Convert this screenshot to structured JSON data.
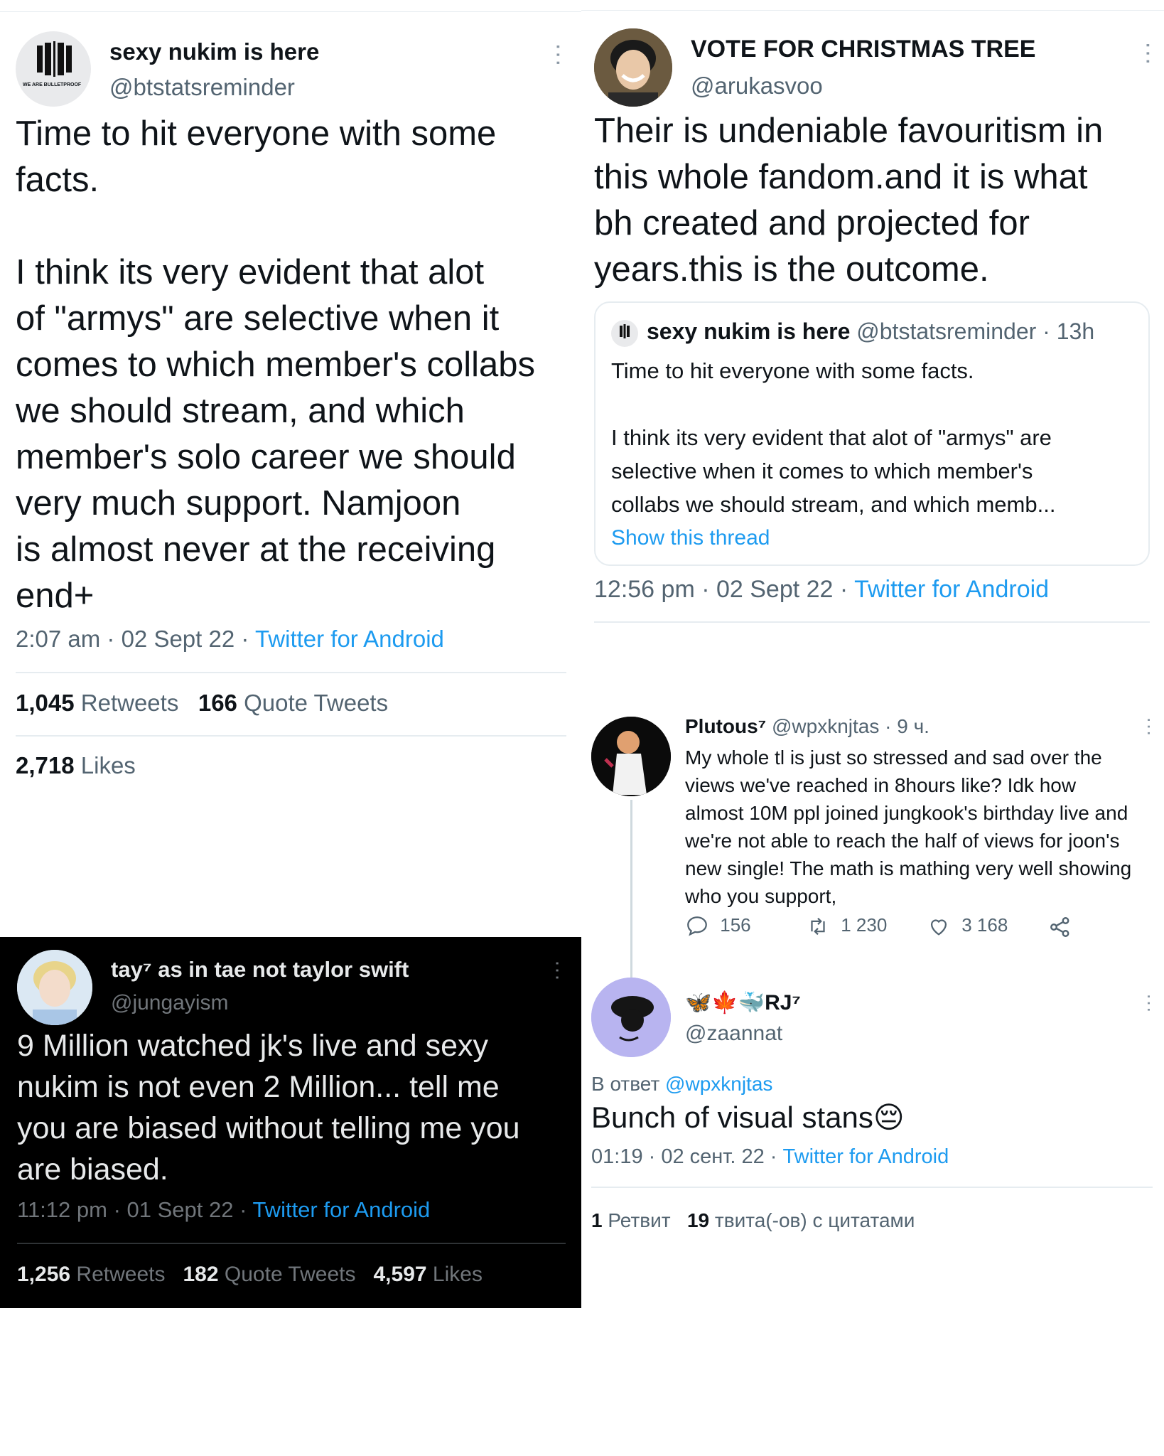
{
  "tweet1": {
    "name": "sexy nukim is here",
    "handle": "@btstatsreminder",
    "avatar_caption": "WE ARE BULLETPROOF",
    "text": "Time to hit everyone with some\nfacts.\n\nI think its very evident that alot\nof \"armys\" are selective when it\ncomes to which member's collabs\nwe should stream, and which\nmember's solo career we should\nvery much support. Namjoon\nis almost never at the receiving\nend+",
    "meta_time": "2:07 am · 02 Sept 22 · ",
    "meta_source": "Twitter for Android",
    "retweets_count": "1,045",
    "retweets_label": "Retweets",
    "quotes_count": "166",
    "quotes_label": "Quote Tweets",
    "likes_count": "2,718",
    "likes_label": "Likes"
  },
  "tweet2": {
    "name": "VOTE FOR CHRISTMAS TREE",
    "handle": "@arukasvoo",
    "text": "Their is undeniable favouritism in\nthis whole fandom.and it is what\nbh created and projected for\nyears.this is the outcome.",
    "quote": {
      "name": "sexy nukim is here",
      "handle_time": "@btstatsreminder · 13h",
      "text": "Time to hit everyone with some facts.\n\nI think its very evident that alot of \"armys\" are\nselective when it comes to which member's\ncollabs we should stream, and which memb...",
      "show_thread": "Show this thread"
    },
    "meta_time": "12:56 pm · 02 Sept 22 · ",
    "meta_source": "Twitter for Android"
  },
  "tweet3": {
    "name": "Plutous⁷",
    "handle_time": "@wpxknjtas · 9 ч.",
    "text": "My whole tl is just so stressed and sad over the\nviews we've reached in 8hours like? Idk how\nalmost 10M ppl joined jungkook's birthday live and\nwe're not able to reach the half of views for joon's\nnew single! The math is mathing very well showing\nwho you support,",
    "replies": "156",
    "retweets": "1 230",
    "likes": "3 168"
  },
  "tweet4": {
    "name_emoji": "🦋🍁🐳",
    "name": "RJ⁷",
    "handle": "@zaannat",
    "reply_prefix": "В ответ ",
    "reply_to": "@wpxknjtas",
    "text": "Bunch of visual stans",
    "text_emoji": "😔",
    "meta_time": "01:19 · 02 сент. 22 · ",
    "meta_source": "Twitter for Android",
    "retweets_count": "1",
    "retweets_label": "Ретвит",
    "quotes_count": "19",
    "quotes_label": "твита(-ов) с цитатами"
  },
  "tweet5": {
    "name": "tay⁷ as in tae not taylor swift",
    "handle": "@jungayism",
    "text": "9 Million watched jk's live and sexy\nnukim is not even 2 Million... tell me\nyou are biased without telling me you\nare biased.",
    "meta_time": "11:12 pm · 01 Sept 22 · ",
    "meta_source": "Twitter for Android",
    "retweets_count": "1,256",
    "retweets_label": "Retweets",
    "quotes_count": "182",
    "quotes_label": "Quote Tweets",
    "likes_count": "4,597",
    "likes_label": "Likes"
  },
  "colors": {
    "link": "#1d9bf0",
    "muted": "#536471",
    "dark_bg": "#000000"
  }
}
